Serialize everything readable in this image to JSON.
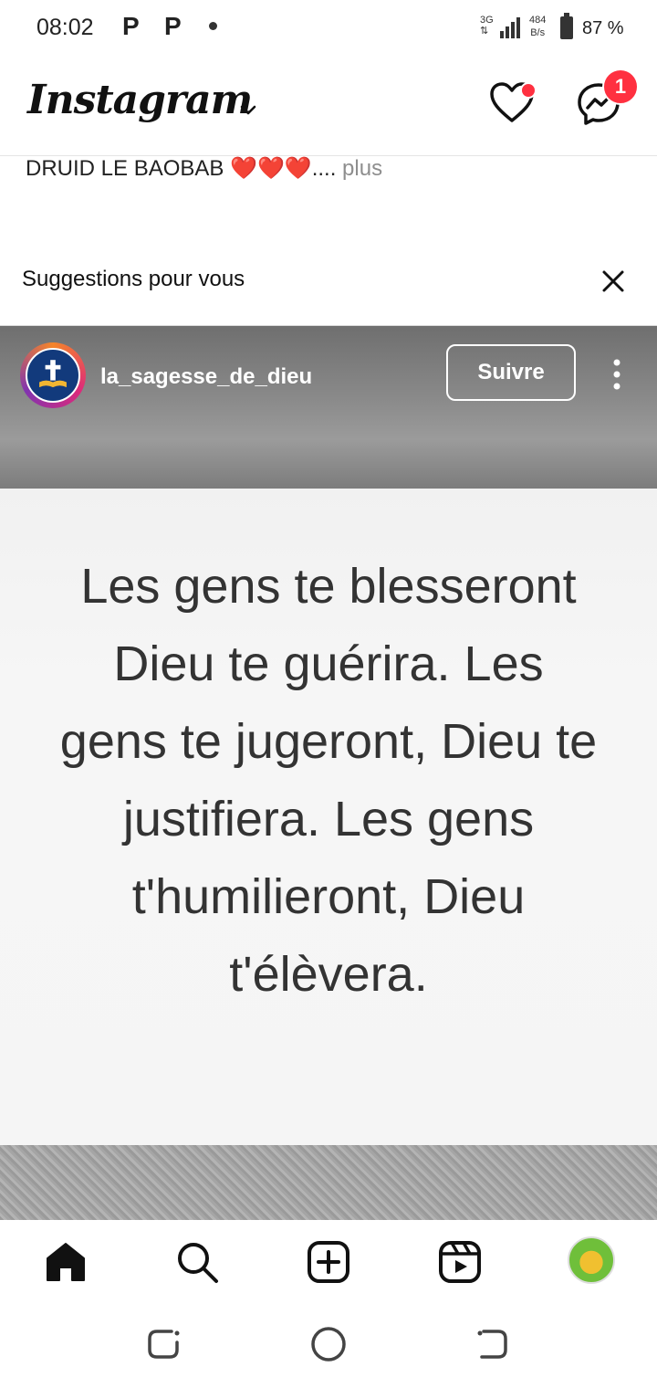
{
  "status_bar": {
    "time": "08:02",
    "notif_1": "P",
    "notif_2": "P",
    "network_type": "3G",
    "speed_value": "484",
    "speed_unit": "B/s",
    "battery": "87 %"
  },
  "header": {
    "logo": "Instagram",
    "messages_badge": "1"
  },
  "feed": {
    "caption_text": "DRUID LE BAOBAB ❤️❤️❤️....",
    "caption_more": " plus",
    "suggestions_title": "Suggestions pour vous"
  },
  "post": {
    "username": "la_sagesse_de_dieu",
    "follow_label": "Suivre",
    "quote": "Les gens te blesseront Dieu te guérira. Les gens te jugeront, Dieu te justifiera. Les gens t'humilieront, Dieu t'élèvera."
  },
  "bottom_nav": {
    "items": [
      "home-icon",
      "search-icon",
      "create-icon",
      "reels-icon",
      "profile-avatar"
    ]
  },
  "colors": {
    "notification_red": "#ff3040",
    "text": "#111111",
    "muted": "#8e8e8e"
  }
}
